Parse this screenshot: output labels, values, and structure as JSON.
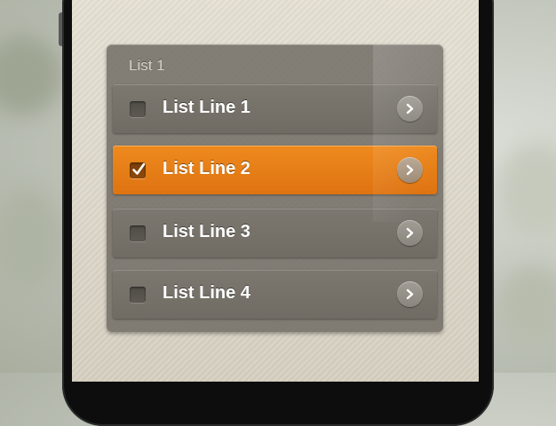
{
  "list": {
    "title": "List 1",
    "items": [
      {
        "label": "List Line 1",
        "checked": false
      },
      {
        "label": "List Line 2",
        "checked": true
      },
      {
        "label": "List Line 3",
        "checked": false
      },
      {
        "label": "List Line 4",
        "checked": false
      }
    ]
  },
  "colors": {
    "accent": "#e47a14",
    "row": "#75716a",
    "panel": "#6c6860",
    "label": "#ffffff"
  },
  "icons": {
    "checkmark": "check-icon",
    "chevron": "chevron-right-icon"
  }
}
